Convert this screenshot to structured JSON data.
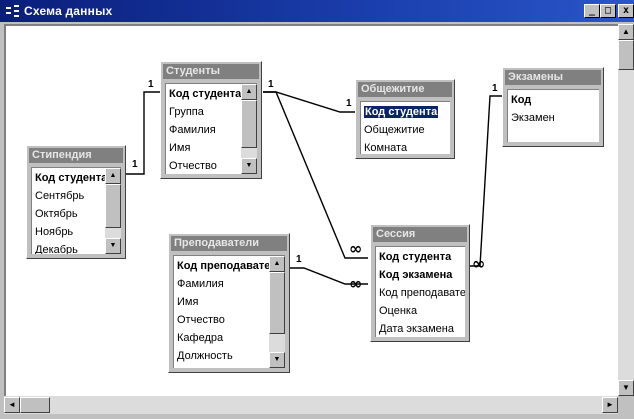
{
  "window": {
    "title": "Схема данных",
    "buttons": {
      "minimize": "_",
      "maximize": "□",
      "close": "x"
    }
  },
  "tables": {
    "stipendiya": {
      "name": "Стипендия",
      "fields": [
        "Код студента",
        "Сентябрь",
        "Октябрь",
        "Ноябрь",
        "Декабрь"
      ]
    },
    "studenty": {
      "name": "Студенты",
      "fields": [
        "Код студента",
        "Группа",
        "Фамилия",
        "Имя",
        "Отчество"
      ]
    },
    "obshchezhitie": {
      "name": "Общежитие",
      "fields": [
        "Код студента",
        "Общежитие",
        "Комната"
      ]
    },
    "ekzameny": {
      "name": "Экзамены",
      "fields": [
        "Код",
        "Экзамен"
      ]
    },
    "prepodavateli": {
      "name": "Преподаватели",
      "fields": [
        "Код преподавателя",
        "Фамилия",
        "Имя",
        "Отчество",
        "Кафедра",
        "Должность"
      ]
    },
    "sessiya": {
      "name": "Сессия",
      "fields": [
        "Код студента",
        "Код экзамена",
        "Код преподавателя",
        "Оценка",
        "Дата экзамена"
      ]
    }
  },
  "relations": {
    "one": "1",
    "many": "∞"
  },
  "scroll": {
    "up": "▲",
    "down": "▼",
    "left": "◄",
    "right": "►"
  }
}
